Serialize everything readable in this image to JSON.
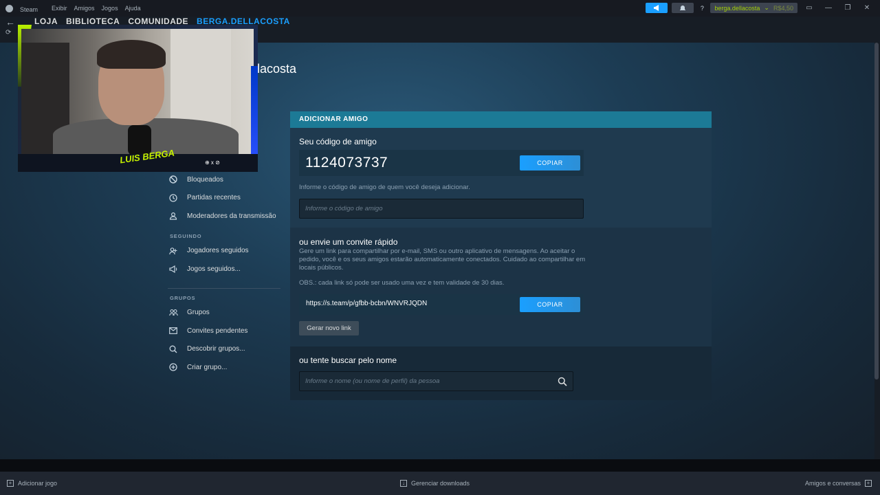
{
  "titlebar": {
    "app": "Steam",
    "menu": [
      "Exibir",
      "Amigos",
      "Jogos",
      "Ajuda"
    ],
    "help": "?",
    "account": "berga.dellacosta",
    "balance": "R$4,50"
  },
  "nav": {
    "tabs": [
      "LOJA",
      "BIBLIOTECA",
      "COMUNIDADE",
      "BERGA.DELLACOSTA"
    ]
  },
  "profile": {
    "name_partial": "llacosta"
  },
  "webcam": {
    "logo": "LUIS BERGA",
    "social": "⊕ x ⊘"
  },
  "sidebar": {
    "items_top": [
      {
        "label": "Bloqueados",
        "icon": "block-icon"
      },
      {
        "label": "Partidas recentes",
        "icon": "clock-icon"
      },
      {
        "label": "Moderadores da transmissão",
        "icon": "moderator-icon"
      }
    ],
    "section_following": "SEGUINDO",
    "items_following": [
      {
        "label": "Jogadores seguidos",
        "icon": "followed-players-icon"
      },
      {
        "label": "Jogos seguidos...",
        "icon": "followed-games-icon"
      }
    ],
    "section_groups": "GRUPOS",
    "items_groups": [
      {
        "label": "Grupos",
        "icon": "groups-icon"
      },
      {
        "label": "Convites pendentes",
        "icon": "envelope-icon"
      },
      {
        "label": "Descobrir grupos...",
        "icon": "search-icon"
      },
      {
        "label": "Criar grupo...",
        "icon": "plus-circle-icon"
      }
    ]
  },
  "panel": {
    "header": "ADICIONAR AMIGO",
    "friend_code_title": "Seu código de amigo",
    "friend_code": "1124073737",
    "copy_label": "COPIAR",
    "enter_code_hint": "Informe o código de amigo de quem você deseja adicionar.",
    "enter_code_placeholder": "Informe o código de amigo",
    "quick_invite_title": "ou envie um convite rápido",
    "quick_invite_desc": "Gere um link para compartilhar por e-mail, SMS ou outro aplicativo de mensagens. Ao aceitar o pedido, você e os seus amigos estarão automaticamente conectados. Cuidado ao compartilhar em locais públicos.",
    "quick_invite_note": "OBS.: cada link só pode ser usado uma vez e tem validade de 30 dias.",
    "invite_link": "https://s.team/p/gfbb-bcbn/WNVRJQDN",
    "copy_label2": "COPIAR",
    "generate_link": "Gerar novo link",
    "search_title": "ou tente buscar pelo nome",
    "search_placeholder": "Informe o nome (ou nome de perfil) da pessoa"
  },
  "statusbar": {
    "add_game": "Adicionar jogo",
    "downloads": "Gerenciar downloads",
    "friends": "Amigos e conversas"
  }
}
